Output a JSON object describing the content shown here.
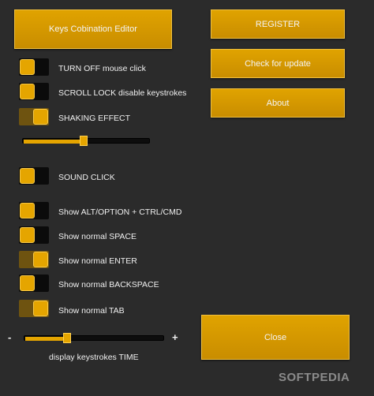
{
  "buttons": {
    "keys_combination_editor": "Keys Cobination Editor",
    "register": "REGISTER",
    "check_for_update": "Check for update",
    "about": "About",
    "close": "Close"
  },
  "toggles": [
    {
      "label": "TURN OFF  mouse click",
      "on": false
    },
    {
      "label": "SCROLL LOCK disable keystrokes",
      "on": false
    },
    {
      "label": "SHAKING EFFECT",
      "on": true
    },
    {
      "label": "SOUND CLICK",
      "on": false
    },
    {
      "label": "Show ALT/OPTION + CTRL/CMD",
      "on": false
    },
    {
      "label": "Show normal SPACE",
      "on": false
    },
    {
      "label": "Show normal ENTER",
      "on": true
    },
    {
      "label": "Show normal BACKSPACE",
      "on": false
    },
    {
      "label": "Show normal TAB",
      "on": true
    }
  ],
  "shake_slider": {
    "value_fraction": 0.48
  },
  "time_slider": {
    "value_fraction": 0.3,
    "minus": "-",
    "plus": "+",
    "label": "display keystrokes TIME"
  },
  "watermark": "SOFTPEDIA",
  "colors": {
    "accent": "#e5a500",
    "background": "#2b2b2b",
    "toggle_off": "#0b0b0b",
    "toggle_on": "#6e5310"
  }
}
